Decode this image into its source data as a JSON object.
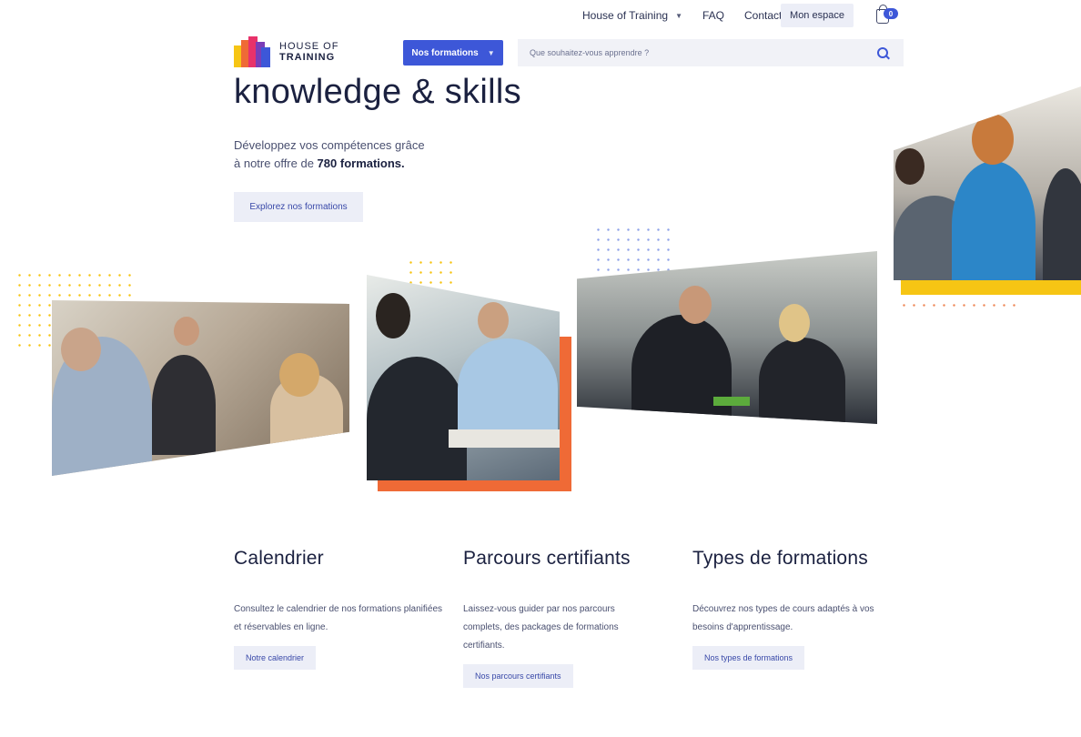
{
  "topnav": {
    "house_of_training": "House of Training",
    "faq": "FAQ",
    "contact": "Contact",
    "mon_espace": "Mon espace",
    "cart_count": "0"
  },
  "header": {
    "logo_line1": "HOUSE OF",
    "logo_line2": "TRAINING",
    "nos_formations": "Nos formations",
    "search_placeholder": "Que souhaitez-vous apprendre ?"
  },
  "hero": {
    "title": "knowledge & skills",
    "subtitle_line1": "Développez vos compétences grâce",
    "subtitle_line2_prefix": "à notre offre de ",
    "subtitle_count": "780",
    "subtitle_suffix": " formations.",
    "cta": "Explorez nos formations"
  },
  "sections": [
    {
      "title": "Calendrier",
      "text": "Consultez le calendrier de nos formations planifiées et réservables en ligne.",
      "button": "Notre calendrier"
    },
    {
      "title": "Parcours certifiants",
      "text": "Laissez-vous guider par nos parcours complets, des packages de formations certifiants.",
      "button": "Nos parcours certifiants"
    },
    {
      "title": "Types de formations",
      "text": "Découvrez nos types de cours adaptés à vos besoins d'apprentissage.",
      "button": "Nos types de formations"
    }
  ],
  "colors": {
    "accent_blue": "#3d57d8",
    "orange": "#ef6a36",
    "yellow": "#f6c514",
    "text_dark": "#1b2140"
  }
}
